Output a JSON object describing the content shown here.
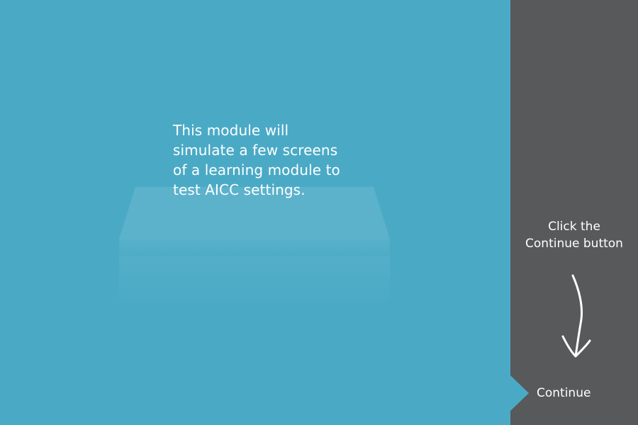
{
  "main": {
    "intro_text": "This module will simulate a few screens of a learning module to test AICC settings."
  },
  "side_panel": {
    "hint_text": "Click the Continue button",
    "continue_label": "Continue"
  },
  "colors": {
    "stage_background": "#4aaac6",
    "side_panel_background": "#58595b",
    "text": "#ffffff"
  },
  "icons": {
    "hint_arrow": "hand-drawn-down-arrow-icon"
  }
}
